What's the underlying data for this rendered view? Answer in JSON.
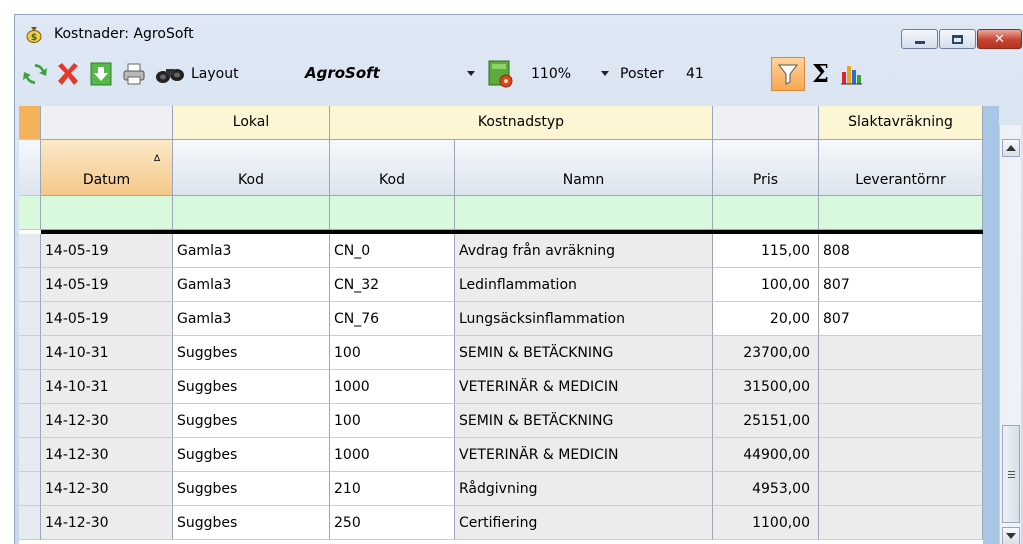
{
  "window": {
    "title": "Kostnader: AgroSoft"
  },
  "toolbar": {
    "layout_label": "Layout",
    "layout_value": "AgroSoft",
    "zoom_value": "110%",
    "poster_label": "Poster",
    "poster_value": "41",
    "sum_symbol": "Σ"
  },
  "grid": {
    "bands": {
      "lokal": "Lokal",
      "kostnadstyp": "Kostnadstyp",
      "slaktavrakning": "Slaktavräkning"
    },
    "headers": {
      "datum": "Datum",
      "sort_indicator": "∆",
      "lokal_kod": "Kod",
      "kost_kod": "Kod",
      "namn": "Namn",
      "pris": "Pris",
      "leverantornr": "Leverantörnr"
    },
    "rows": [
      {
        "datum": "14-05-19",
        "lokal": "Gamla3",
        "kod": "CN_0",
        "namn": "Avdrag från avräkning",
        "pris": "115,00",
        "lev": "808"
      },
      {
        "datum": "14-05-19",
        "lokal": "Gamla3",
        "kod": "CN_32",
        "namn": "Ledinflammation",
        "pris": "100,00",
        "lev": "807"
      },
      {
        "datum": "14-05-19",
        "lokal": "Gamla3",
        "kod": "CN_76",
        "namn": "Lungsäcksinflammation",
        "pris": "20,00",
        "lev": "807"
      },
      {
        "datum": "14-10-31",
        "lokal": "Suggbes",
        "kod": "100",
        "namn": "SEMIN & BETÄCKNING",
        "pris": "23700,00",
        "lev": ""
      },
      {
        "datum": "14-10-31",
        "lokal": "Suggbes",
        "kod": "1000",
        "namn": "VETERINÄR & MEDICIN",
        "pris": "31500,00",
        "lev": ""
      },
      {
        "datum": "14-12-30",
        "lokal": "Suggbes",
        "kod": "100",
        "namn": "SEMIN & BETÄCKNING",
        "pris": "25151,00",
        "lev": ""
      },
      {
        "datum": "14-12-30",
        "lokal": "Suggbes",
        "kod": "1000",
        "namn": "VETERINÄR & MEDICIN",
        "pris": "44900,00",
        "lev": ""
      },
      {
        "datum": "14-12-30",
        "lokal": "Suggbes",
        "kod": "210",
        "namn": "Rådgivning",
        "pris": "4953,00",
        "lev": ""
      },
      {
        "datum": "14-12-30",
        "lokal": "Suggbes",
        "kod": "250",
        "namn": "Certifiering",
        "pris": "1100,00",
        "lev": ""
      }
    ]
  },
  "colors": {
    "band_bg": "#fdf6d4",
    "filter_row_bg": "#d9f9dc",
    "filter_button_bg": "#f7a752",
    "shaded_cell_bg": "#ececec"
  },
  "icons": [
    "app-money-bag-icon",
    "refresh-icon",
    "delete-icon",
    "download-icon",
    "print-icon",
    "binoculars-icon",
    "layout-settings-icon",
    "filter-icon",
    "sum-icon",
    "chart-icon"
  ]
}
